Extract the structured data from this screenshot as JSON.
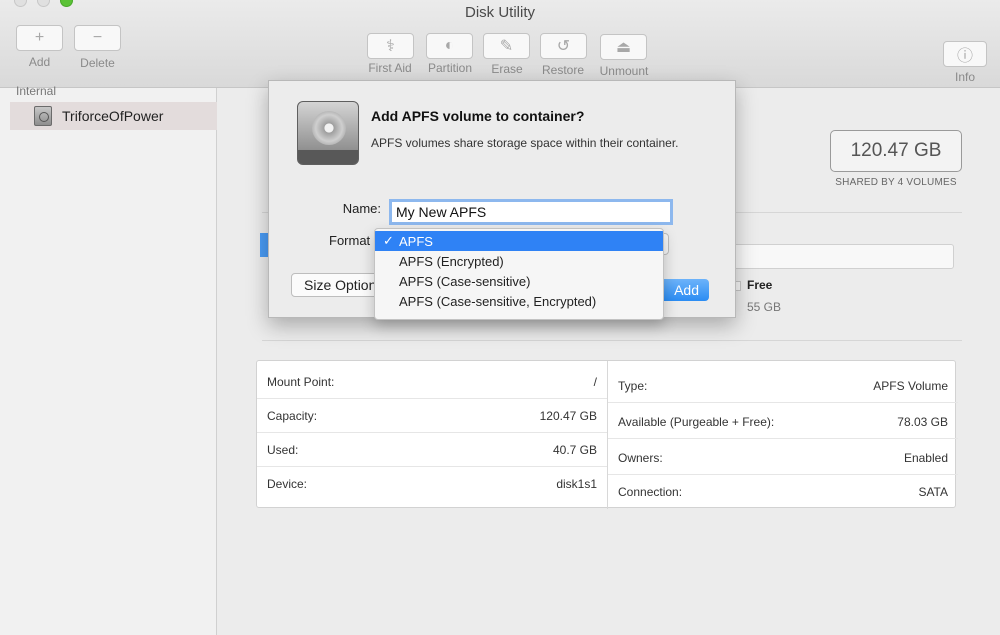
{
  "window": {
    "title": "Disk Utility"
  },
  "toolbar": {
    "add": "Add",
    "delete": "Delete",
    "first_aid": "First Aid",
    "partition": "Partition",
    "erase": "Erase",
    "restore": "Restore",
    "unmount": "Unmount",
    "info": "Info"
  },
  "sidebar": {
    "section": "Internal",
    "items": [
      {
        "label": "TriforceOfPower"
      }
    ]
  },
  "volume": {
    "capacity": "120.47 GB",
    "shared_label": "SHARED BY 4 VOLUMES",
    "free_label": "Free",
    "free_value": "55 GB"
  },
  "info": {
    "left": [
      {
        "label": "Mount Point:",
        "value": "/"
      },
      {
        "label": "Capacity:",
        "value": "120.47 GB"
      },
      {
        "label": "Used:",
        "value": "40.7 GB"
      },
      {
        "label": "Device:",
        "value": "disk1s1"
      }
    ],
    "right": [
      {
        "label": "Type:",
        "value": "APFS Volume"
      },
      {
        "label": "Available (Purgeable + Free):",
        "value": "78.03 GB"
      },
      {
        "label": "Owners:",
        "value": "Enabled"
      },
      {
        "label": "Connection:",
        "value": "SATA"
      }
    ]
  },
  "dialog": {
    "title": "Add APFS volume to container?",
    "subtitle": "APFS volumes share storage space within their container.",
    "name_label": "Name:",
    "name_value": "My New APFS",
    "format_label": "Format",
    "size_button": "Size Options...",
    "add_button": "Add"
  },
  "format_menu": {
    "check": "✓",
    "options": [
      "APFS",
      "APFS (Encrypted)",
      "APFS (Case-sensitive)",
      "APFS (Case-sensitive, Encrypted)"
    ],
    "selected": "APFS"
  }
}
